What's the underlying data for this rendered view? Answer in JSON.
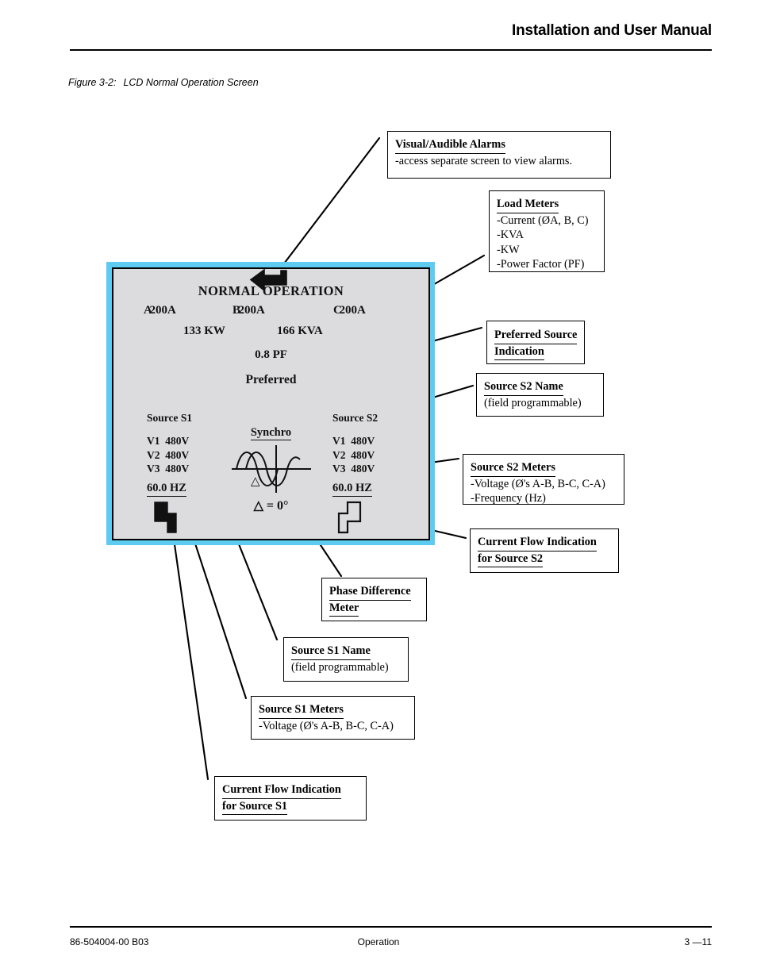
{
  "header": {
    "title": "Installation and User Manual"
  },
  "figure": {
    "number": "Figure 3-2:",
    "caption": "LCD Normal Operation Screen"
  },
  "footer": {
    "doc_number": "86-504004-00 B03",
    "section": "Operation",
    "page": "3 —11"
  },
  "lcd": {
    "title": "NORMAL OPERATION",
    "currents": [
      {
        "phase": "A",
        "value": "200A"
      },
      {
        "phase": "B",
        "value": "200A"
      },
      {
        "phase": "C",
        "value": "200A"
      }
    ],
    "power": {
      "kw": "133  KW",
      "kva": "166  KVA"
    },
    "power_factor": "0.8  PF",
    "preferred_label": "Preferred",
    "preferred_arrow_icon": "return-arrow-icon",
    "source_s1": {
      "name": "Source S1",
      "voltages": [
        {
          "label": "V1",
          "value": "480V"
        },
        {
          "label": "V2",
          "value": "480V"
        },
        {
          "label": "V3",
          "value": "480V"
        }
      ],
      "frequency": "60.0 HZ",
      "flow_icon": "current-flow-filled-icon"
    },
    "source_s2": {
      "name": "Source S2",
      "voltages": [
        {
          "label": "V1",
          "value": "480V"
        },
        {
          "label": "V2",
          "value": "480V"
        },
        {
          "label": "V3",
          "value": "480V"
        }
      ],
      "frequency": "60.0 HZ",
      "flow_icon": "current-flow-outline-icon"
    },
    "synchro": {
      "title": "Synchro",
      "delta_marker": "△",
      "phase_difference": "△ = 0°"
    }
  },
  "callouts": {
    "alarms": {
      "head": "Visual/Audible Alarms",
      "lines": [
        "-access separate screen to view alarms."
      ]
    },
    "load": {
      "head": "Load Meters",
      "lines": [
        "-Current (ØA, B, C)",
        "-KVA",
        "-KW",
        "-Power Factor (PF)"
      ]
    },
    "preferred": {
      "head_line1": "Preferred Source",
      "head_line2": "Indication"
    },
    "s2name": {
      "head": "Source S2 Name",
      "lines": [
        "(field programmable)"
      ]
    },
    "s2meters": {
      "head": "Source S2 Meters",
      "lines": [
        "-Voltage (Ø's A-B, B-C, C-A)",
        "-Frequency (Hz)"
      ]
    },
    "flow_s2": {
      "head_line1": "Current Flow Indication",
      "head_line2": "for Source S2"
    },
    "phase": {
      "head_line1": "Phase Difference",
      "head_line2": "Meter"
    },
    "s1name": {
      "head": "Source S1 Name",
      "lines": [
        "(field programmable)"
      ]
    },
    "s1meters": {
      "head": "Source S1 Meters",
      "lines": [
        "-Voltage (Ø's A-B, B-C, C-A)"
      ]
    },
    "flow_s1": {
      "head_line1": "Current Flow Indication",
      "head_line2": "for Source S1"
    }
  },
  "colors": {
    "lcd_bezel": "#5ECBF0",
    "lcd_screen": "#DCDCDE",
    "ink": "#000000"
  }
}
